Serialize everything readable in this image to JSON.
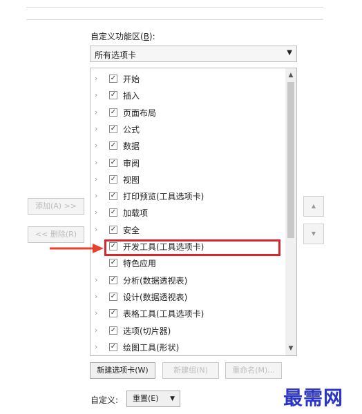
{
  "customize_ribbon_label": "自定义功能区(",
  "customize_ribbon_key": "B",
  "customize_ribbon_suffix": "):",
  "dropdown_value": "所有选项卡",
  "dropdown_arrow": "▼",
  "tabs": [
    {
      "label": "开始",
      "checked": true,
      "expandable": true
    },
    {
      "label": "插入",
      "checked": true,
      "expandable": true
    },
    {
      "label": "页面布局",
      "checked": true,
      "expandable": true
    },
    {
      "label": "公式",
      "checked": true,
      "expandable": true
    },
    {
      "label": "数据",
      "checked": true,
      "expandable": true
    },
    {
      "label": "审阅",
      "checked": true,
      "expandable": true
    },
    {
      "label": "视图",
      "checked": true,
      "expandable": true
    },
    {
      "label": "打印预览(工具选项卡)",
      "checked": true,
      "expandable": true
    },
    {
      "label": "加载项",
      "checked": true,
      "expandable": true
    },
    {
      "label": "安全",
      "checked": true,
      "expandable": true
    },
    {
      "label": "开发工具(工具选项卡)",
      "checked": true,
      "expandable": true
    },
    {
      "label": "特色应用",
      "checked": true,
      "expandable": false
    },
    {
      "label": "分析(数据透视表)",
      "checked": true,
      "expandable": true
    },
    {
      "label": "设计(数据透视表)",
      "checked": true,
      "expandable": true
    },
    {
      "label": "表格工具(工具选项卡)",
      "checked": true,
      "expandable": true
    },
    {
      "label": "选项(切片器)",
      "checked": true,
      "expandable": true
    },
    {
      "label": "绘图工具(形状)",
      "checked": true,
      "expandable": true
    }
  ],
  "add_button": "添加(A) >>",
  "remove_button": "<< 删除(R)",
  "new_tab_button": "新建选项卡(W)",
  "new_group_button": "新建组(N)",
  "rename_button": "重命名(M)...",
  "customize_label": "自定义:",
  "reset_button": "重置(E)",
  "reset_arrow": "▼",
  "watermark": "最需网",
  "colors": {
    "highlight": "#d9262c",
    "arrow": "#e8402f",
    "watermark": "#2a35c7"
  }
}
